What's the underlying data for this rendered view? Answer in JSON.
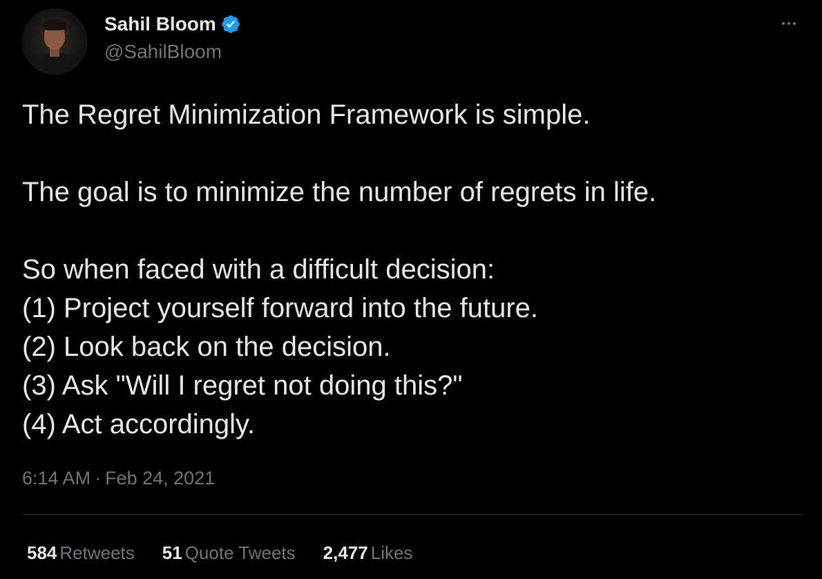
{
  "author": {
    "display_name": "Sahil Bloom",
    "handle": "@SahilBloom",
    "verified": true,
    "avatar_icon": "profile-photo"
  },
  "tweet": {
    "lines": [
      "The Regret Minimization Framework is simple.",
      "",
      "The goal is to minimize the number of regrets in life.",
      "",
      "So when faced with a difficult decision:",
      "(1) Project yourself forward into the future.",
      "(2) Look back on the decision.",
      "(3) Ask \"Will I regret not doing this?\"",
      "(4) Act accordingly."
    ],
    "time": "6:14 AM",
    "separator": "·",
    "date": "Feb 24, 2021"
  },
  "stats": {
    "retweets_count": "584",
    "retweets_label": "Retweets",
    "quotes_count": "51",
    "quotes_label": "Quote Tweets",
    "likes_count": "2,477",
    "likes_label": "Likes"
  },
  "colors": {
    "background": "#000000",
    "primary_text": "#e7e9ea",
    "secondary_text": "#71767b",
    "verified_badge": "#1d9bf0",
    "divider": "#2f3336"
  }
}
